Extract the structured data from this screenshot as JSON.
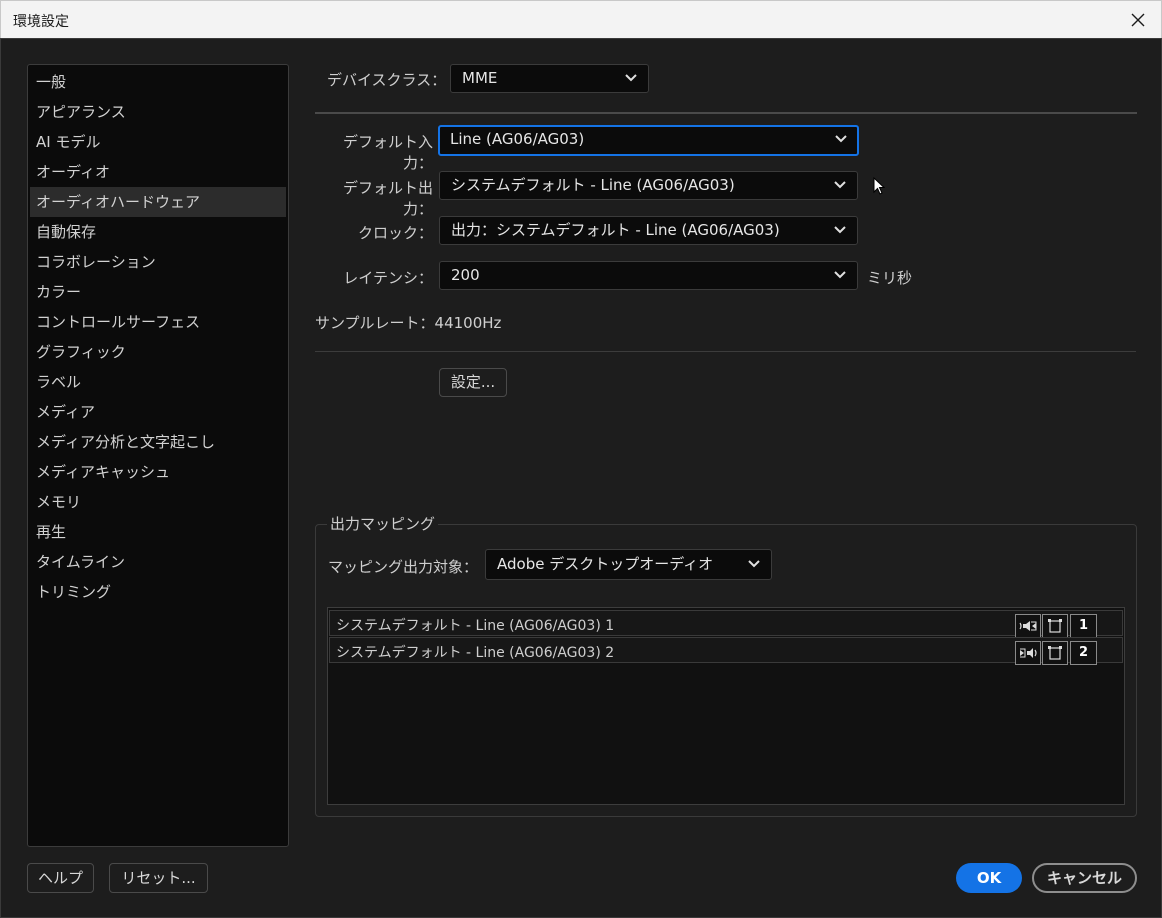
{
  "window": {
    "title": "環境設定"
  },
  "sidebar": {
    "items": [
      {
        "label": "一般"
      },
      {
        "label": "アピアランス"
      },
      {
        "label": "AI モデル"
      },
      {
        "label": "オーディオ"
      },
      {
        "label": "オーディオハードウェア",
        "selected": true
      },
      {
        "label": "自動保存"
      },
      {
        "label": "コラボレーション"
      },
      {
        "label": "カラー"
      },
      {
        "label": "コントロールサーフェス"
      },
      {
        "label": "グラフィック"
      },
      {
        "label": "ラベル"
      },
      {
        "label": "メディア"
      },
      {
        "label": "メディア分析と文字起こし"
      },
      {
        "label": "メディアキャッシュ"
      },
      {
        "label": "メモリ"
      },
      {
        "label": "再生"
      },
      {
        "label": "タイムライン"
      },
      {
        "label": "トリミング"
      }
    ]
  },
  "device_class": {
    "label": "デバイスクラス：",
    "value": "MME"
  },
  "default_input": {
    "label": "デフォルト入力：",
    "value": "Line (AG06/AG03)"
  },
  "default_output": {
    "label": "デフォルト出力：",
    "value": "システムデフォルト - Line (AG06/AG03)"
  },
  "clock": {
    "label": "クロック：",
    "value": "出力：システムデフォルト - Line (AG06/AG03)"
  },
  "latency": {
    "label": "レイテンシ：",
    "value": "200",
    "unit": "ミリ秒"
  },
  "sample_rate": {
    "text": "サンプルレート：44100Hz"
  },
  "settings_button": "設定...",
  "output_mapping": {
    "title": "出力マッピング",
    "target_label": "マッピング出力対象：",
    "target_value": "Adobe デスクトップオーディオ",
    "rows": [
      {
        "label": "システムデフォルト - Line (AG06/AG03) 1",
        "channel": "1"
      },
      {
        "label": "システムデフォルト - Line (AG06/AG03) 2",
        "channel": "2"
      }
    ]
  },
  "footer": {
    "help": "ヘルプ",
    "reset": "リセット...",
    "ok": "OK",
    "cancel": "キャンセル"
  },
  "colors": {
    "accent": "#1473e6",
    "background": "#1d1d1d",
    "list_bg": "#0b0b0b"
  }
}
